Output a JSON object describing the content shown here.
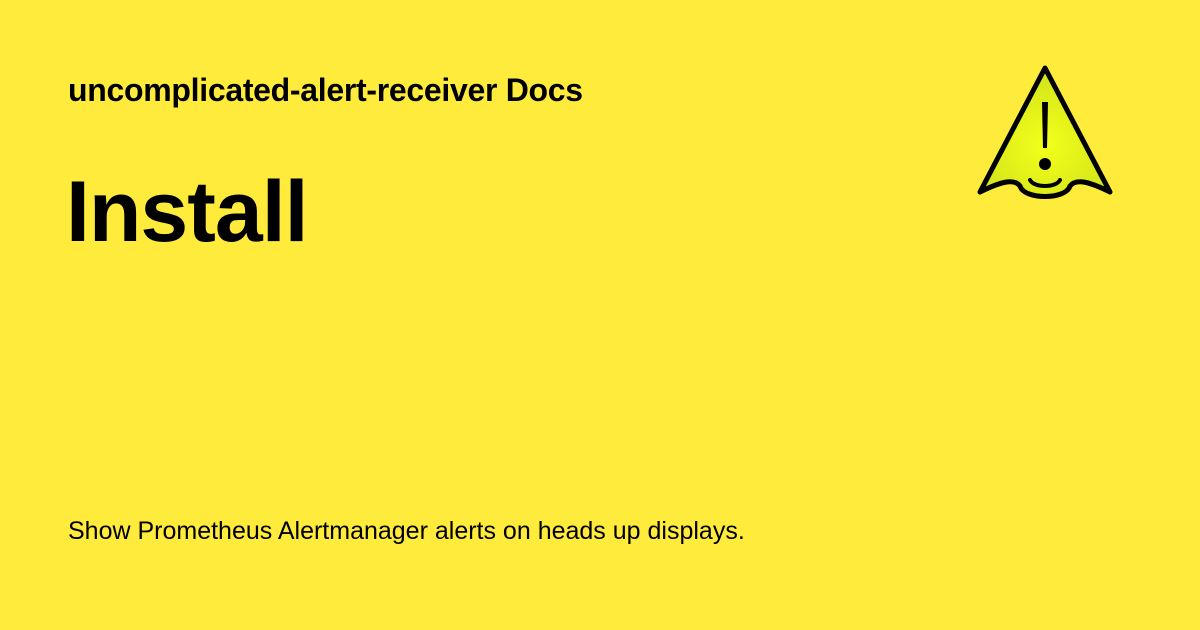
{
  "site": {
    "name": "uncomplicated-alert-receiver Docs"
  },
  "page": {
    "title": "Install",
    "description": "Show Prometheus Alertmanager alerts on heads up displays."
  },
  "logo": {
    "icon": "warning-triangle-icon"
  },
  "colors": {
    "background": "#ffeb3b",
    "text": "#000000",
    "logo_fill_center": "#f4ff1a",
    "logo_fill_edge": "#cfe31a",
    "logo_stroke": "#000000"
  }
}
